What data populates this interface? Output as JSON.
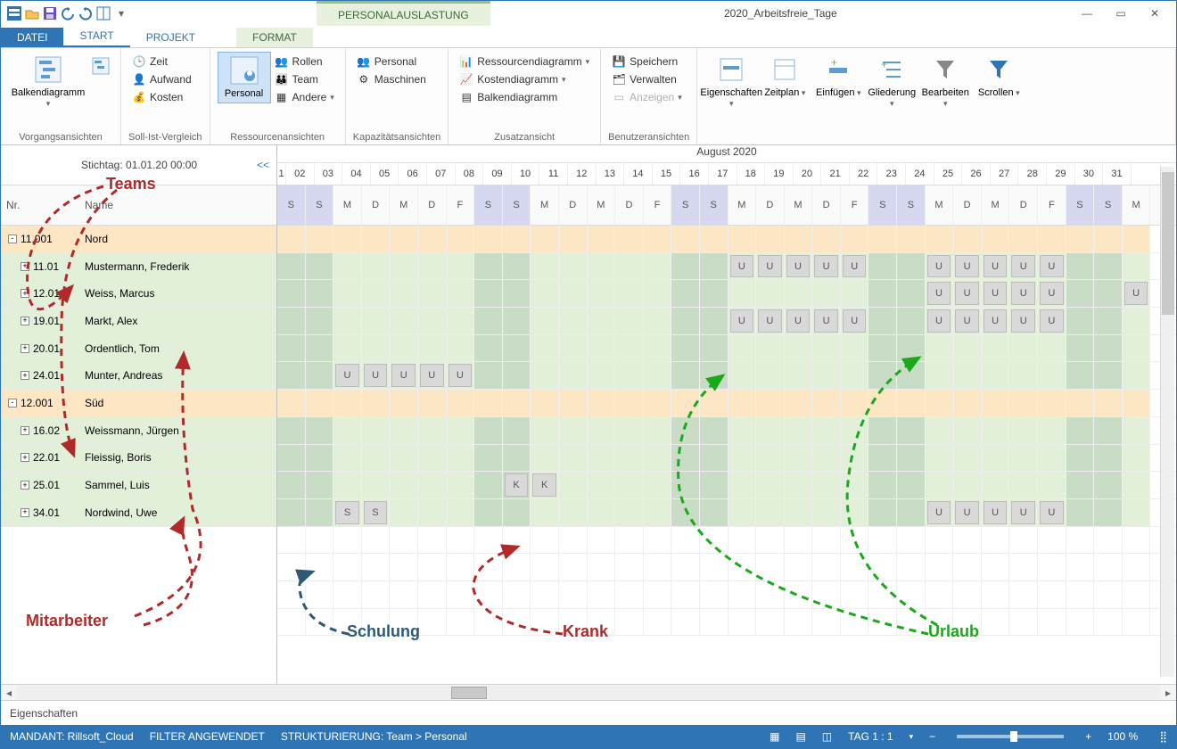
{
  "window": {
    "doc_title": "2020_Arbeitsfreie_Tage"
  },
  "contextual_tab": "PERSONALAUSLASTUNG",
  "tabs": {
    "file": "DATEI",
    "start": "START",
    "projekt": "PROJEKT",
    "format": "FORMAT"
  },
  "ribbon": {
    "group1": {
      "balken": "Balkendiagramm",
      "label": "Vorgangsansichten"
    },
    "group2": {
      "zeit": "Zeit",
      "aufwand": "Aufwand",
      "kosten": "Kosten",
      "label": "Soll-Ist-Vergleich"
    },
    "group3": {
      "personal": "Personal",
      "rollen": "Rollen",
      "team": "Team",
      "andere": "Andere",
      "label": "Ressourcenansichten"
    },
    "group4": {
      "personal": "Personal",
      "maschinen": "Maschinen",
      "label": "Kapazitätsansichten"
    },
    "group5": {
      "ress": "Ressourcendiagramm",
      "kost": "Kostendiagramm",
      "balken": "Balkendiagramm",
      "label": "Zusatzansicht"
    },
    "group6": {
      "speichern": "Speichern",
      "verwalten": "Verwalten",
      "anzeigen": "Anzeigen",
      "label": "Benutzeransichten"
    },
    "group7": {
      "eig": "Eigenschaften",
      "zeit": "Zeitplan",
      "einf": "Einfügen",
      "glied": "Gliederung",
      "bearb": "Bearbeiten",
      "scroll": "Scrollen"
    }
  },
  "stichtag": {
    "label": "Stichtag: 01.01.20 00:00",
    "back": "<<"
  },
  "left_cols": {
    "nr": "Nr.",
    "name": "Name"
  },
  "month": "August 2020",
  "days": [
    "1",
    "02",
    "03",
    "04",
    "05",
    "06",
    "07",
    "08",
    "09",
    "10",
    "11",
    "12",
    "13",
    "14",
    "15",
    "16",
    "17",
    "18",
    "19",
    "20",
    "21",
    "22",
    "23",
    "24",
    "25",
    "26",
    "27",
    "28",
    "29",
    "30",
    "31"
  ],
  "weekdays": [
    "S",
    "S",
    "M",
    "D",
    "M",
    "D",
    "F",
    "S",
    "S",
    "M",
    "D",
    "M",
    "D",
    "F",
    "S",
    "S",
    "M",
    "D",
    "M",
    "D",
    "F",
    "S",
    "S",
    "M",
    "D",
    "M",
    "D",
    "F",
    "S",
    "S",
    "M"
  ],
  "rows": [
    {
      "type": "team",
      "nr": "11.001",
      "name": "Nord",
      "exp": "-"
    },
    {
      "type": "member",
      "nr": "11.01",
      "name": "Mustermann, Frederik",
      "exp": "+",
      "cells": {
        "17": "U",
        "18": "U",
        "19": "U",
        "20": "U",
        "21": "U",
        "24": "U",
        "25": "U",
        "26": "U",
        "27": "U",
        "28": "U"
      }
    },
    {
      "type": "member",
      "nr": "12.01",
      "name": "Weiss, Marcus",
      "exp": "+",
      "cells": {
        "24": "U",
        "25": "U",
        "26": "U",
        "27": "U",
        "28": "U",
        "31": "U"
      }
    },
    {
      "type": "member",
      "nr": "19.01",
      "name": "Markt, Alex",
      "exp": "+",
      "cells": {
        "17": "U",
        "18": "U",
        "19": "U",
        "20": "U",
        "21": "U",
        "24": "U",
        "25": "U",
        "26": "U",
        "27": "U",
        "28": "U"
      }
    },
    {
      "type": "member",
      "nr": "20.01",
      "name": "Ordentlich, Tom",
      "exp": "+",
      "cells": {}
    },
    {
      "type": "member",
      "nr": "24.01",
      "name": "Munter, Andreas",
      "exp": "+",
      "cells": {
        "03": "U",
        "04": "U",
        "05": "U",
        "06": "U",
        "07": "U"
      }
    },
    {
      "type": "team",
      "nr": "12.001",
      "name": "Süd",
      "exp": "-"
    },
    {
      "type": "member",
      "nr": "16.02",
      "name": "Weissmann, Jürgen",
      "exp": "+",
      "cells": {}
    },
    {
      "type": "member",
      "nr": "22.01",
      "name": "Fleissig, Boris",
      "exp": "+",
      "cells": {}
    },
    {
      "type": "member",
      "nr": "25.01",
      "name": "Sammel, Luis",
      "exp": "+",
      "cells": {
        "09": "K",
        "10": "K"
      }
    },
    {
      "type": "member",
      "nr": "34.01",
      "name": "Nordwind, Uwe",
      "exp": "+",
      "cells": {
        "03": "S",
        "04": "S",
        "24": "U",
        "25": "U",
        "26": "U",
        "27": "U",
        "28": "U"
      }
    }
  ],
  "annotations": {
    "teams": "Teams",
    "mitarbeiter": "Mitarbeiter",
    "schulung": "Schulung",
    "krank": "Krank",
    "urlaub": "Urlaub"
  },
  "props_label": "Eigenschaften",
  "status": {
    "mandant": "MANDANT: Rillsoft_Cloud",
    "filter": "FILTER ANGEWENDET",
    "strukt": "STRUKTURIERUNG: Team > Personal",
    "tag": "TAG 1 : 1",
    "zoom": "100 %",
    "minus": "−",
    "plus": "+"
  }
}
